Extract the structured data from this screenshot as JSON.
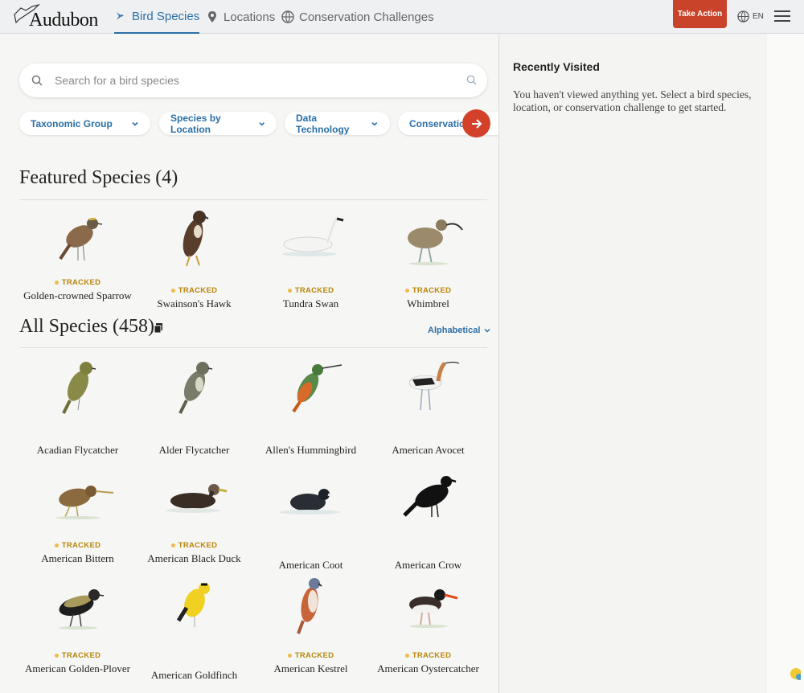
{
  "header": {
    "logo_text": "Audubon",
    "nav": [
      {
        "label": "Bird Species",
        "icon": "bird-icon"
      },
      {
        "label": "Locations",
        "icon": "pin-icon"
      },
      {
        "label": "Conservation Challenges",
        "icon": "globe-icon"
      }
    ],
    "take_action": "Take Action",
    "language": "EN"
  },
  "search": {
    "placeholder": "Search for a bird species"
  },
  "filters": [
    {
      "label": "Taxonomic Group"
    },
    {
      "label": "Species by Location"
    },
    {
      "label": "Data Technology"
    },
    {
      "label": "Conservation"
    }
  ],
  "featured": {
    "title": "Featured Species (4)",
    "items": [
      {
        "name": "Golden-crowned Sparrow",
        "tracked": "TRACKED"
      },
      {
        "name": "Swainson's Hawk",
        "tracked": "TRACKED"
      },
      {
        "name": "Tundra Swan",
        "tracked": "TRACKED"
      },
      {
        "name": "Whimbrel",
        "tracked": "TRACKED"
      }
    ]
  },
  "all": {
    "title": "All Species (458)",
    "sort": "Alphabetical",
    "items": [
      {
        "name": "Acadian Flycatcher",
        "tracked": ""
      },
      {
        "name": "Alder Flycatcher",
        "tracked": ""
      },
      {
        "name": "Allen's Hummingbird",
        "tracked": ""
      },
      {
        "name": "American Avocet",
        "tracked": ""
      },
      {
        "name": "American Bittern",
        "tracked": "TRACKED"
      },
      {
        "name": "American Black Duck",
        "tracked": "TRACKED"
      },
      {
        "name": "American Coot",
        "tracked": ""
      },
      {
        "name": "American Crow",
        "tracked": ""
      },
      {
        "name": "American Golden-Plover",
        "tracked": "TRACKED"
      },
      {
        "name": "American Goldfinch",
        "tracked": ""
      },
      {
        "name": "American Kestrel",
        "tracked": "TRACKED"
      },
      {
        "name": "American Oystercatcher",
        "tracked": "TRACKED"
      }
    ]
  },
  "recent": {
    "title": "Recently Visited",
    "text": "You haven't viewed anything yet. Select a bird species, location, or conservation challenge to get started."
  },
  "colors": {
    "accent": "#2a6fa8",
    "action": "#c9432a",
    "tracked": "#b8860b"
  }
}
